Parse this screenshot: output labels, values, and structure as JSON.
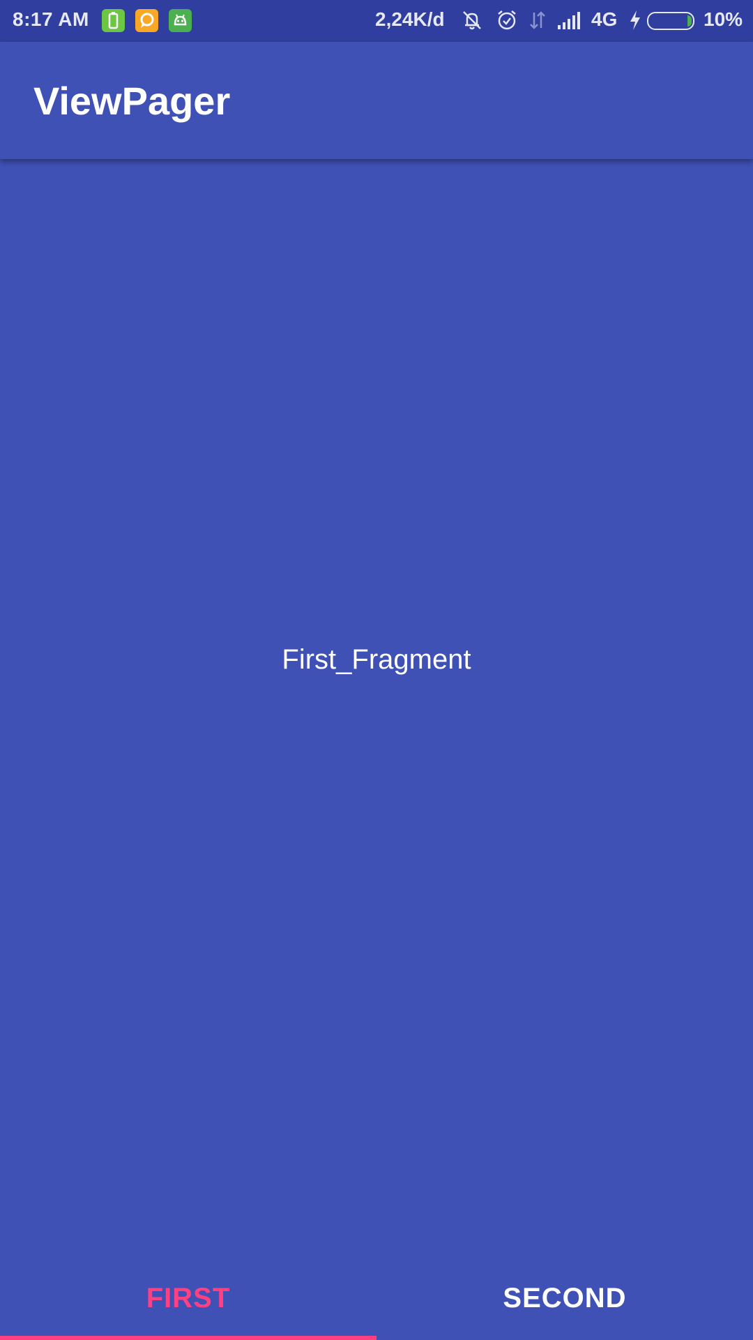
{
  "status_bar": {
    "time": "8:17 AM",
    "app_icons": [
      {
        "icon": "battery-app-icon",
        "color": "#6CC644"
      },
      {
        "icon": "chat-app-icon",
        "color": "#F9A825"
      },
      {
        "icon": "android-app-icon",
        "color": "#4CAF50"
      }
    ],
    "network_speed": "2,24K/d",
    "icons": [
      "bell-muted-icon",
      "alarm-icon",
      "data-arrows-icon",
      "signal-icon",
      "charging-icon"
    ],
    "network_type": "4G",
    "battery_percent": "10%",
    "battery_level": 0.1,
    "background": "#303F9F"
  },
  "app_bar": {
    "title": "ViewPager",
    "background": "#3F51B5"
  },
  "content": {
    "fragment_label": "First_Fragment"
  },
  "tabs": {
    "items": [
      {
        "label": "FIRST",
        "selected": true
      },
      {
        "label": "SECOND",
        "selected": false
      }
    ],
    "accent": "#FF4081",
    "unselected_color": "#FFFFFF"
  }
}
